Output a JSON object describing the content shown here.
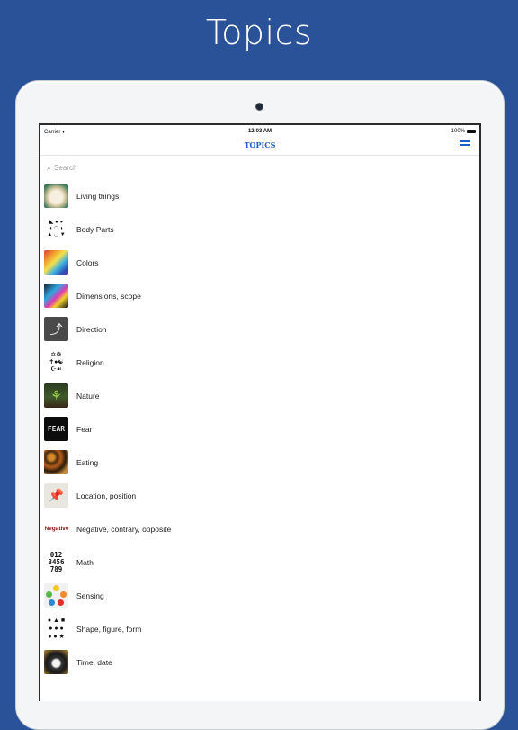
{
  "headline": "Topics",
  "status_bar": {
    "carrier": "Carrier",
    "time": "12:03 AM",
    "battery": "100%"
  },
  "nav": {
    "title": "TOPICS",
    "menu_icon": "hamburger-menu-icon"
  },
  "search": {
    "placeholder": "Search",
    "icon": "search-icon"
  },
  "topics": [
    {
      "label": "Living things",
      "icon": "puppy-image"
    },
    {
      "label": "Body Parts",
      "icon": "body-parts-glyphs"
    },
    {
      "label": "Colors",
      "icon": "rainbow-image"
    },
    {
      "label": "Dimensions, scope",
      "icon": "prism-image"
    },
    {
      "label": "Direction",
      "icon": "split-arrow-image"
    },
    {
      "label": "Religion",
      "icon": "religious-symbols"
    },
    {
      "label": "Nature",
      "icon": "sprout-image"
    },
    {
      "label": "Fear",
      "icon": "fear-text-image"
    },
    {
      "label": "Eating",
      "icon": "food-image"
    },
    {
      "label": "Location, position",
      "icon": "map-pin-image"
    },
    {
      "label": "Negative, contrary, opposite",
      "icon": "negative-word-image",
      "icon_text": "Negative"
    },
    {
      "label": "Math",
      "icon": "digits-image",
      "icon_text": "0 1 2 3 4 5 6 7 8 9"
    },
    {
      "label": "Sensing",
      "icon": "senses-diagram"
    },
    {
      "label": "Shape, figure, form",
      "icon": "shapes-image"
    },
    {
      "label": "Time, date",
      "icon": "alarm-clock-image"
    }
  ]
}
